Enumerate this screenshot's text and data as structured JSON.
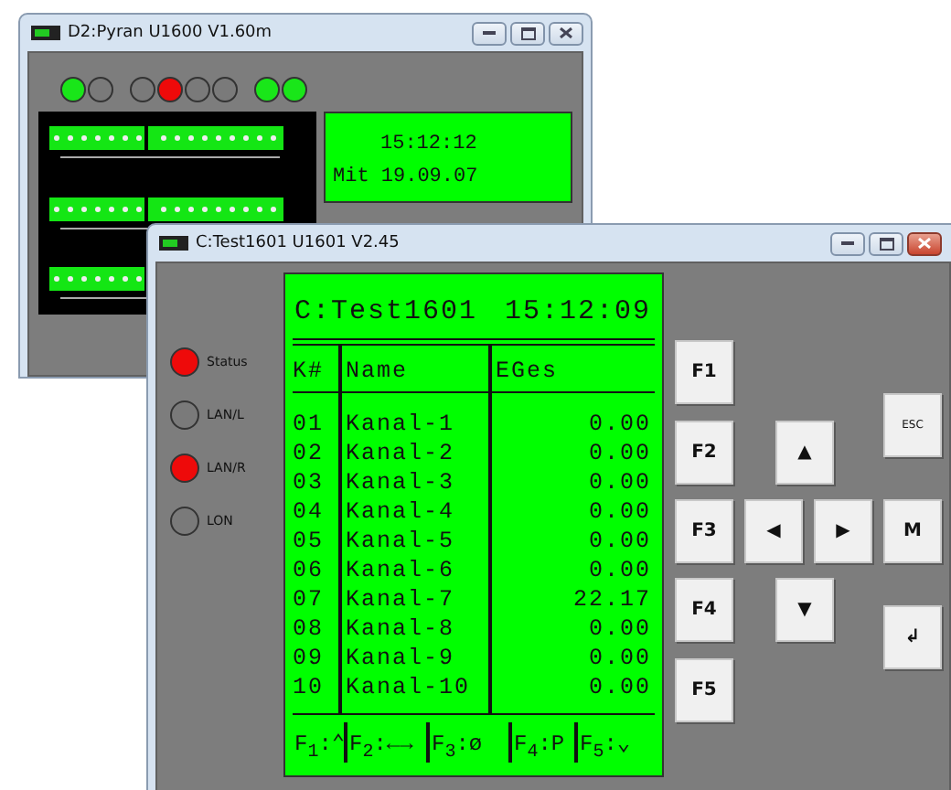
{
  "back_window": {
    "title": "D2:Pyran U1600  V1.60m",
    "leds": [
      {
        "on": true,
        "color": "#19e619"
      },
      {
        "on": false
      },
      {
        "on": false
      },
      {
        "on": true,
        "color": "#ee0a0a"
      },
      {
        "on": false
      },
      {
        "on": false
      },
      {
        "on": true,
        "color": "#19e619"
      },
      {
        "on": true,
        "color": "#19e619"
      }
    ],
    "display": {
      "lines": [
        "15:12:12",
        "Mit 19.09.07"
      ]
    }
  },
  "front_window": {
    "title": "C:Test1601 U1601  V2.45",
    "indicators": [
      {
        "label": "Status",
        "on": true,
        "color": "#ee0a0a"
      },
      {
        "label": "LAN/L",
        "on": false
      },
      {
        "label": "LAN/R",
        "on": true,
        "color": "#ee0a0a"
      },
      {
        "label": "LON",
        "on": false
      }
    ],
    "display": {
      "name": "C:Test1601",
      "time": "15:12:09",
      "columns": [
        "K#",
        "Name",
        "EGes"
      ],
      "rows": [
        [
          "01",
          "Kanal-1",
          "0.00"
        ],
        [
          "02",
          "Kanal-2",
          "0.00"
        ],
        [
          "03",
          "Kanal-3",
          "0.00"
        ],
        [
          "04",
          "Kanal-4",
          "0.00"
        ],
        [
          "05",
          "Kanal-5",
          "0.00"
        ],
        [
          "06",
          "Kanal-6",
          "0.00"
        ],
        [
          "07",
          "Kanal-7",
          "22.17"
        ],
        [
          "08",
          "Kanal-8",
          "0.00"
        ],
        [
          "09",
          "Kanal-9",
          "0.00"
        ],
        [
          "10",
          "Kanal-10",
          "0.00"
        ]
      ],
      "footer": [
        "F$_{1}$:⌃",
        "F$_{2}$:←→",
        "F$_{3}$:ø",
        "F$_{4}$:P",
        "F$_{5}$:⌄"
      ]
    },
    "keys": [
      "F1",
      "F2",
      "F3",
      "F4",
      "F5",
      "▲",
      "◀",
      "▶",
      "▼",
      "ESC",
      "M",
      "↲"
    ]
  }
}
